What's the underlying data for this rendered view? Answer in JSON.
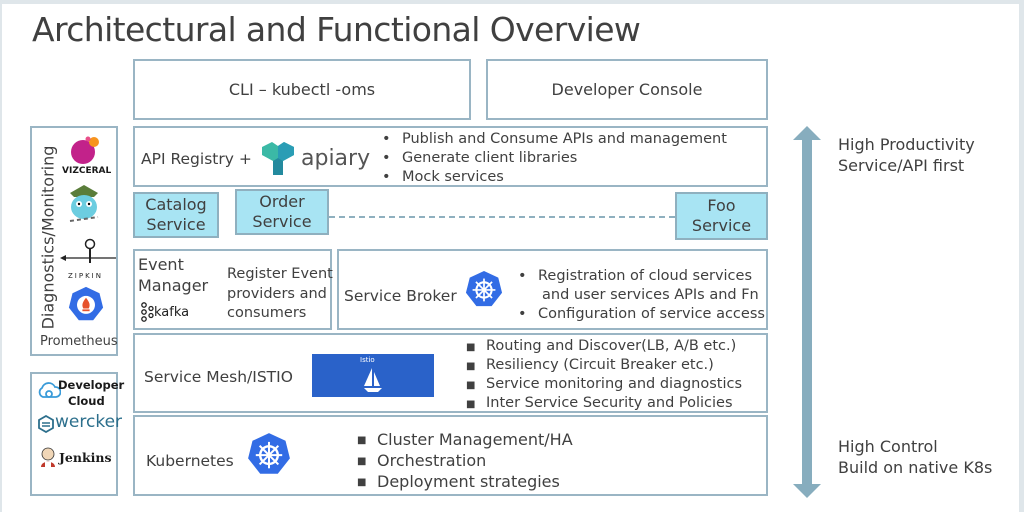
{
  "title": "Architectural and Functional Overview",
  "top_boxes": {
    "cli": "CLI – kubectl -oms",
    "console": "Developer Console"
  },
  "api_registry": {
    "label": "API Registry +",
    "logo_text": "apiary",
    "bullets": [
      "Publish and Consume APIs and management",
      "Generate client libraries",
      "Mock services"
    ]
  },
  "services": {
    "catalog": [
      "Catalog",
      "Service"
    ],
    "order": [
      "Order",
      "Service"
    ],
    "foo": [
      "Foo",
      "Service"
    ]
  },
  "event_manager": {
    "label_line1": "Event",
    "label_line2": "Manager",
    "logo_text": "kafka",
    "description": [
      "Register Event",
      "providers and",
      "consumers"
    ]
  },
  "service_broker": {
    "label": "Service Broker",
    "bullets": [
      "Registration of cloud services",
      "and user services APIs and Fn",
      "Configuration of service access"
    ]
  },
  "service_mesh": {
    "label": "Service Mesh/ISTIO",
    "logo_text": "Istio",
    "bullets": [
      "Routing and Discover(LB, A/B etc.)",
      "Resiliency (Circuit Breaker etc.)",
      "Service monitoring and diagnostics",
      "Inter Service Security and Policies"
    ]
  },
  "kubernetes": {
    "label": "Kubernetes",
    "bullets": [
      "Cluster Management/HA",
      "Orchestration",
      "Deployment strategies"
    ]
  },
  "diagnostics": {
    "label": "Diagnostics/Monitoring",
    "tools": [
      "VIZCERAL",
      "ZIPKIN",
      "Prometheus"
    ]
  },
  "ci_tools": {
    "developer_cloud": [
      "Developer",
      "Cloud"
    ],
    "wercker": "wercker",
    "jenkins": "Jenkins"
  },
  "arrow": {
    "top_label": [
      "High Productivity",
      "Service/API first"
    ],
    "bottom_label": [
      "High Control",
      "Build on native K8s"
    ]
  },
  "colors": {
    "service_fill": "#a8e4f3",
    "border": "#9ab5c4",
    "arrow": "#87adbe",
    "k8s_blue": "#326ce5",
    "istio_blue": "#2a62c9"
  }
}
